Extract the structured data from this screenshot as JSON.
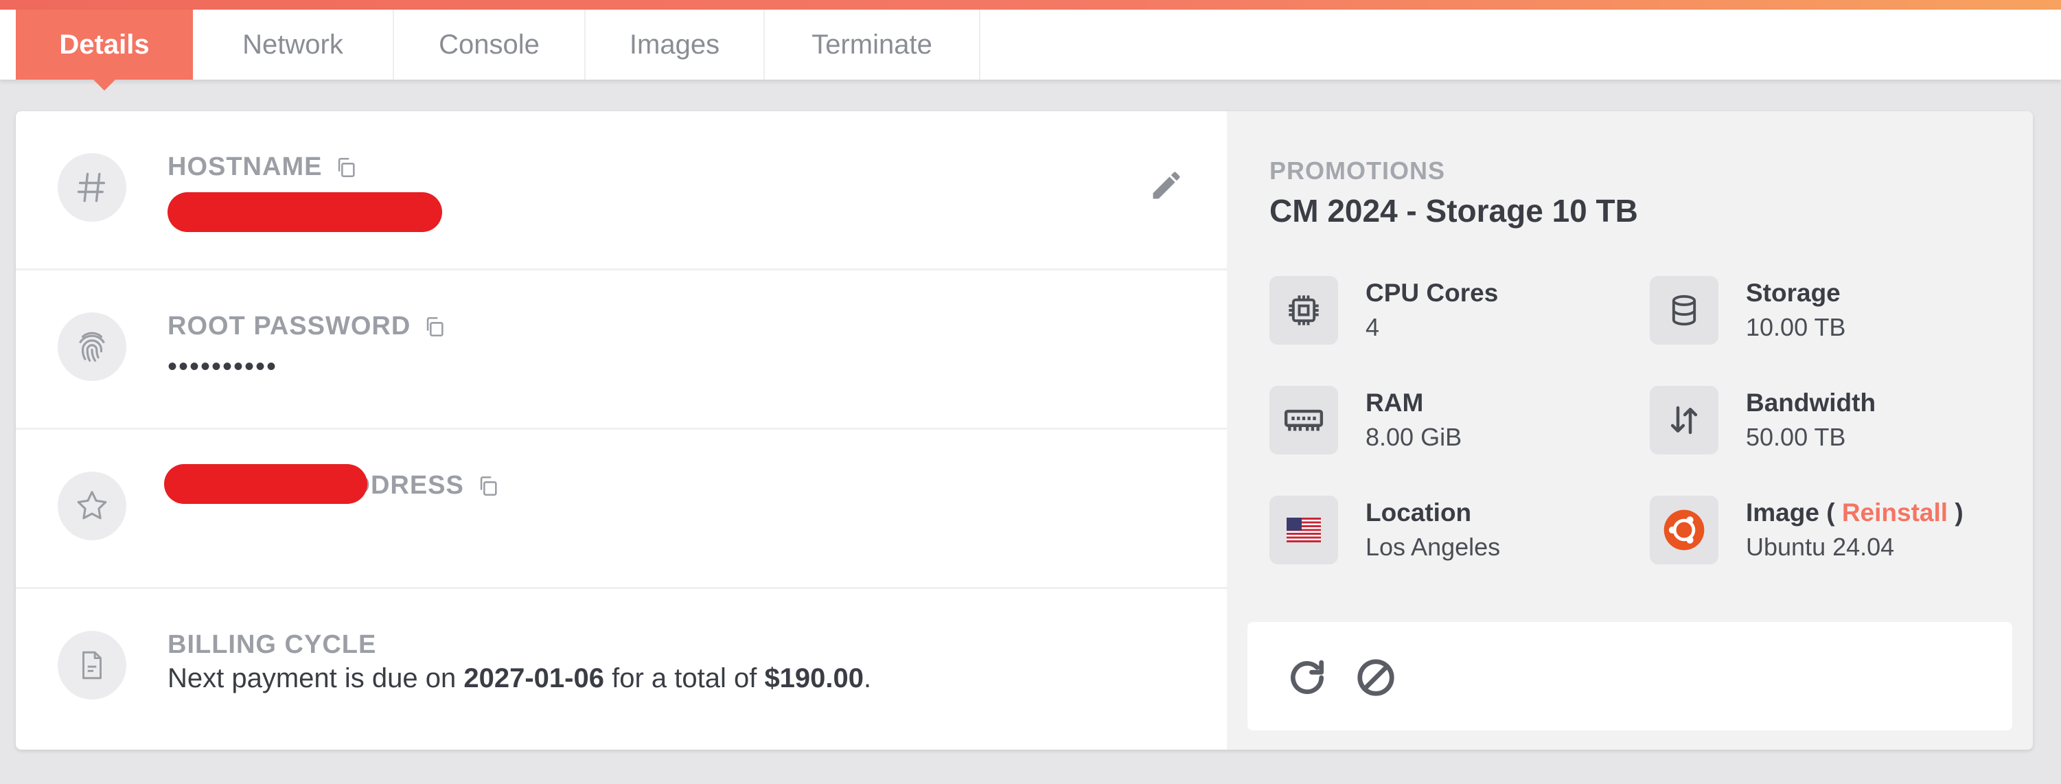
{
  "tabs": [
    {
      "label": "Details",
      "active": true
    },
    {
      "label": "Network",
      "active": false
    },
    {
      "label": "Console",
      "active": false
    },
    {
      "label": "Images",
      "active": false
    },
    {
      "label": "Terminate",
      "active": false
    }
  ],
  "details": {
    "hostname": {
      "label": "HOSTNAME",
      "value": ""
    },
    "root_password": {
      "label": "ROOT PASSWORD",
      "value": "••••••••••"
    },
    "primary_ip": {
      "label": "PRIMARY IP ADDRESS",
      "value": ""
    },
    "billing": {
      "label": "BILLING CYCLE",
      "text_before": "Next payment is due on ",
      "due_date": "2027-01-06",
      "text_middle": " for a total of ",
      "amount": "$190.00",
      "text_after": "."
    }
  },
  "promotions": {
    "label": "PROMOTIONS",
    "title": "CM 2024 - Storage 10 TB"
  },
  "specs": {
    "cpu": {
      "name": "CPU Cores",
      "value": "4",
      "icon": "cpu-icon"
    },
    "storage": {
      "name": "Storage",
      "value": "10.00 TB",
      "icon": "database-icon"
    },
    "ram": {
      "name": "RAM",
      "value": "8.00 GiB",
      "icon": "memory-icon"
    },
    "bandwidth": {
      "name": "Bandwidth",
      "value": "50.00 TB",
      "icon": "transfer-icon"
    },
    "location": {
      "name": "Location",
      "value": "Los Angeles",
      "icon": "us-flag-icon"
    },
    "image": {
      "name_prefix": "Image ( ",
      "reinstall": "Reinstall",
      "name_suffix": " )",
      "value": "Ubuntu 24.04",
      "icon": "ubuntu-icon"
    }
  },
  "colors": {
    "accent": "#f47562",
    "redaction": "#e81e22"
  }
}
